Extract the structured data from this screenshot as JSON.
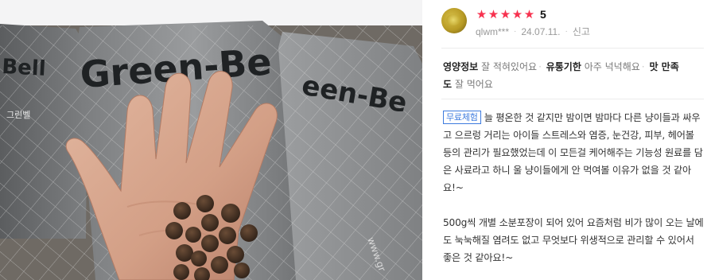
{
  "photo": {
    "bag_text_left": "Bell",
    "bag_text_center": "Green-Be",
    "bag_text_right": "een-Be",
    "bag_small_left": "그린벨",
    "bag_small_right": "www.gr"
  },
  "review": {
    "user": "qlwm***",
    "date": "24.07.11.",
    "report_label": "신고",
    "rating": "5",
    "star_glyph": "★",
    "star_count": 5,
    "star_color": "#f7324f",
    "summary": {
      "k1": "영양정보",
      "v1": "잘 적혀있어요",
      "k2": "유통기한",
      "v2": "아주 넉넉해요",
      "k3": "맛 만족도",
      "v3": "잘 먹어요"
    },
    "badge": "무료체험",
    "para1": "늘 평온한 것 같지만 밤이면 밤마다 다른 냥이들과 싸우고 으르렁 거리는 아이들 스트레스와 염증, 눈건강, 피부, 헤어볼 등의 관리가 필요했었는데 이 모든걸 케어해주는 기능성 원료를 담은 사료라고 하니 울 냥이들에게 안 먹여볼 이유가 없을 것 같아요!~",
    "para2": "500g씩 개별 소분포장이 되어 있어 요즘처럼 비가 많이 오는 날에도 눅눅해질 염려도 없고 무엇보다 위생적으로 관리할 수 있어서 좋은 것 같아요!~"
  }
}
